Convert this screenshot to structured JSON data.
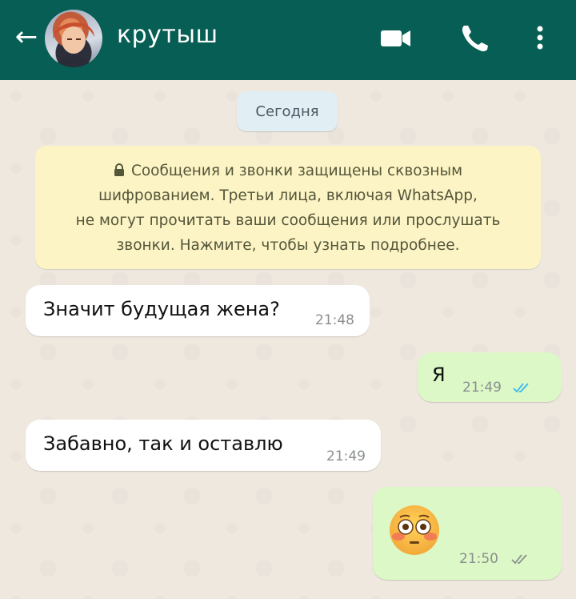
{
  "header": {
    "back_glyph": "←",
    "contact_name": "крутыш",
    "colors": {
      "bar": "#075e54"
    }
  },
  "chat": {
    "date_chip": "Сегодня",
    "encryption_notice": {
      "line1": "Сообщения и звонки защищены сквозным",
      "line2": "шифрованием. Третьи лица, включая WhatsApp,",
      "line3": "не могут прочитать ваши сообщения или прослушать",
      "line4": "звонки. Нажмите, чтобы узнать подробнее."
    },
    "messages": [
      {
        "direction": "incoming",
        "text": "Значит будущая жена?",
        "time": "21:48"
      },
      {
        "direction": "outgoing",
        "text": "Я",
        "time": "21:49",
        "status": "read"
      },
      {
        "direction": "incoming",
        "text": "Забавно, так и оставлю",
        "time": "21:49"
      },
      {
        "direction": "outgoing",
        "text": "😳",
        "time": "21:50",
        "status": "delivered"
      }
    ]
  },
  "icons": {
    "back": "arrow-left-icon",
    "video": "video-camera-icon",
    "call": "phone-icon",
    "menu": "more-vertical-icon",
    "lock": "lock-icon",
    "read_ticks": "double-check-icon",
    "emoji": "flushed-face-emoji"
  }
}
